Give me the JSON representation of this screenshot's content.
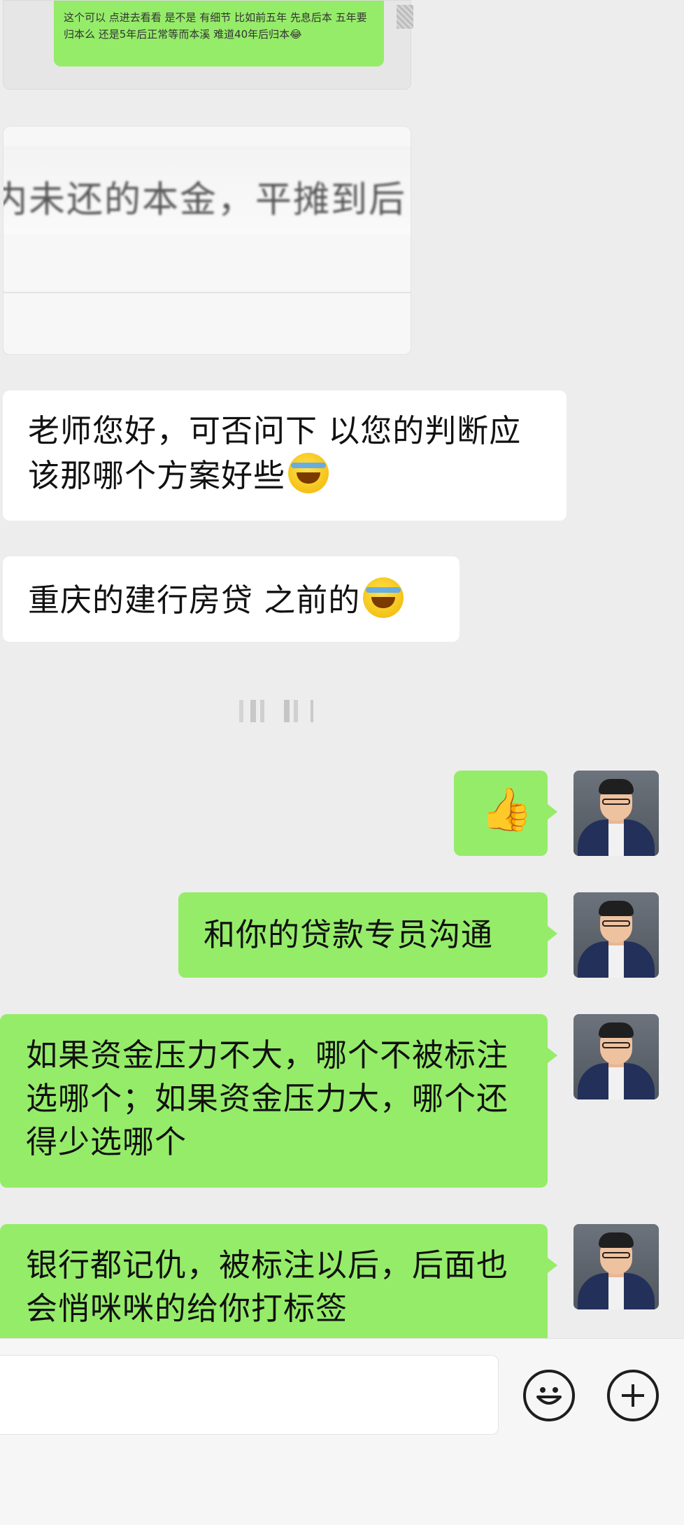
{
  "chat": {
    "quoted_message": {
      "text": "这个可以  点进去看看 是不是 有细节 比如前五年 先息后本 五年要归本么 还是5年后正常等而本溪 难道40年后归本😂"
    },
    "image_message": {
      "visible_text": "内未还的本金，平摊到后"
    },
    "incoming": [
      {
        "text": "老师您好，可否问下 以您的判断应该那哪个方案好些"
      },
      {
        "text": "重庆的建行房贷 之前的"
      }
    ],
    "outgoing": [
      {
        "text": "👍"
      },
      {
        "text": "和你的贷款专员沟通"
      },
      {
        "text": "如果资金压力不大，哪个不被标注选哪个；如果资金压力大，哪个还得少选哪个"
      },
      {
        "text": "银行都记仇，被标注以后，后面也会悄咪咪的给你打标签"
      }
    ]
  },
  "input_bar": {
    "placeholder": "",
    "emoji_icon": "emoji-icon",
    "plus_icon": "plus-icon"
  },
  "colors": {
    "background": "#ededed",
    "outgoing_bubble": "#95ec69",
    "incoming_bubble": "#ffffff"
  }
}
